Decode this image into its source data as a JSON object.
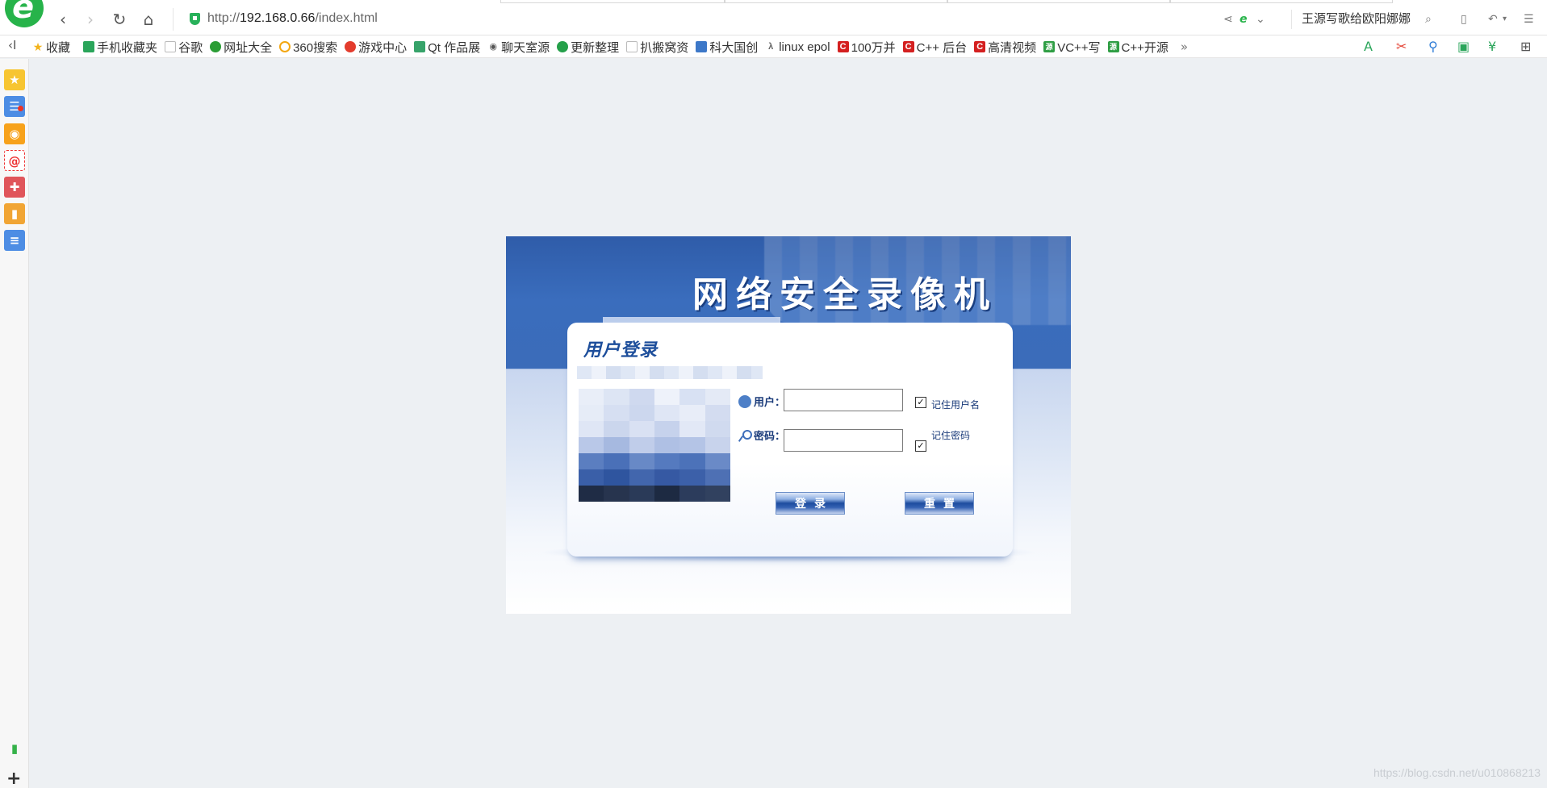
{
  "browser": {
    "url_prefix": "http://",
    "url_host": "192.168.0.66",
    "url_path": "/index.html",
    "news_text": "王源写歌给欧阳娜娜",
    "colors": {
      "brand_green": "#27b34a",
      "secure_green": "#28b15a"
    }
  },
  "bookmarks": {
    "toggle": "‹I",
    "more": "»",
    "items": [
      {
        "label": "收藏",
        "icon": "star-icon",
        "color": "#f3b31b"
      },
      {
        "label": "手机收藏夹",
        "icon": "phone-icon",
        "color": "#2aa55a"
      },
      {
        "label": "谷歌",
        "icon": "page-icon",
        "color": "#bbbbbb"
      },
      {
        "label": "网址大全",
        "icon": "globe-icon",
        "color": "#2b9d35"
      },
      {
        "label": "360搜索",
        "icon": "search-ring-icon",
        "color": "#f3a712"
      },
      {
        "label": "游戏中心",
        "icon": "game-icon",
        "color": "#e33c2d"
      },
      {
        "label": "Qt 作品展",
        "icon": "qt-icon",
        "color": "#37a36a"
      },
      {
        "label": "聊天室源",
        "icon": "eye-icon",
        "color": "#555555"
      },
      {
        "label": "更新整理",
        "icon": "refresh-icon",
        "color": "#25a04a"
      },
      {
        "label": "扒搬窝资",
        "icon": "page-icon",
        "color": "#bbbbbb"
      },
      {
        "label": "科大国创",
        "icon": "shield-icon",
        "color": "#3d78c8"
      },
      {
        "label": "linux epol",
        "icon": "linux-icon",
        "color": "#666666"
      },
      {
        "label": "100万并",
        "icon": "csdn-icon",
        "color": "#d42020"
      },
      {
        "label": "C++ 后台",
        "icon": "csdn-icon",
        "color": "#d42020"
      },
      {
        "label": "高清视频",
        "icon": "csdn-icon",
        "color": "#d42020"
      },
      {
        "label": "VC++写",
        "icon": "source-icon",
        "color": "#2f9e44"
      },
      {
        "label": "C++开源",
        "icon": "source-icon",
        "color": "#2f9e44"
      }
    ]
  },
  "sidebar": {
    "items": [
      {
        "name": "favorites-icon",
        "color": "#f7c531",
        "glyph": "★"
      },
      {
        "name": "news-feed-icon",
        "color": "#4d8de4",
        "glyph": "☰"
      },
      {
        "name": "weibo-icon",
        "color": "#f7a21b",
        "glyph": "◉"
      },
      {
        "name": "mail-icon",
        "color": "#ffffff",
        "glyph": "@"
      },
      {
        "name": "game-controller-icon",
        "color": "#e0555a",
        "glyph": "✚"
      },
      {
        "name": "notebook-icon",
        "color": "#f1a534",
        "glyph": "▮"
      },
      {
        "name": "document-icon",
        "color": "#4d8de4",
        "glyph": "≡"
      }
    ],
    "bottom": {
      "name": "battery-icon",
      "color": "#35b249",
      "glyph": "▮"
    },
    "add": "+"
  },
  "login": {
    "banner_title": "网络安全录像机",
    "card_title": "用户登录",
    "username_label": "用户：",
    "password_label": "密码：",
    "username_value": "",
    "password_value": "",
    "remember_username": "记住用户名",
    "remember_password": "记住密码",
    "remember_username_checked": true,
    "remember_password_checked": true,
    "login_button": "登录",
    "reset_button": "重置",
    "colors": {
      "banner_blue": "#3a6dbd",
      "title_blue": "#1d4e9b",
      "button_blue": "#1d4c9f"
    }
  },
  "watermark": "https://blog.csdn.net/u010868213"
}
